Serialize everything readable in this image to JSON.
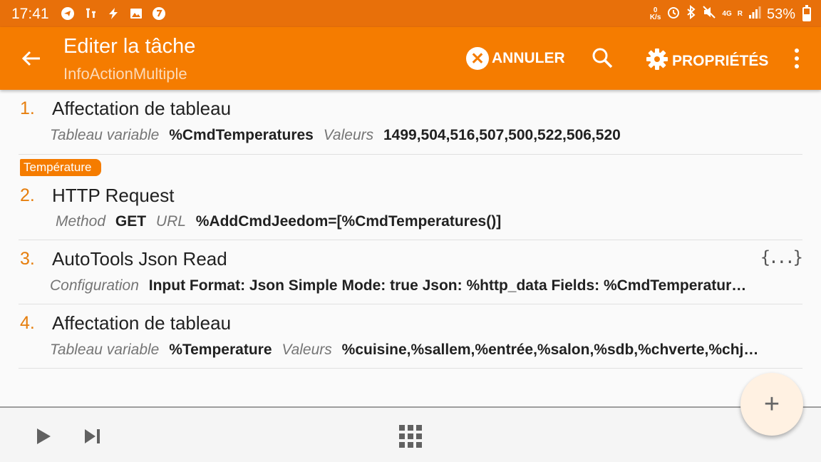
{
  "status_bar": {
    "time": "17:41",
    "left_icons": [
      "telegram-icon",
      "tasker-icon",
      "flash-icon",
      "image-icon",
      "viber-icon"
    ],
    "speed_value": "0",
    "speed_unit": "K/s",
    "net_4g": "4G",
    "net_r": "R",
    "battery": "53%"
  },
  "toolbar": {
    "title": "Editer la tâche",
    "subtitle": "InfoActionMultiple",
    "cancel_label": "ANNULER",
    "properties_label": "PROPRIÉTÉS"
  },
  "actions": [
    {
      "number": "1.",
      "name": "Affectation de tableau",
      "params": [
        {
          "label": "Tableau variable",
          "value": "%CmdTemperatures"
        },
        {
          "label": "Valeurs",
          "value": "1499,504,516,507,500,522,506,520"
        }
      ]
    },
    {
      "number": "2.",
      "tag": "Température",
      "name": "HTTP Request",
      "params": [
        {
          "label": "Method",
          "value": "GET"
        },
        {
          "label": "URL",
          "value": "%AddCmdJeedom=[%CmdTemperatures()]"
        }
      ]
    },
    {
      "number": "3.",
      "name": "AutoTools Json Read",
      "icon": "{...}",
      "params": [
        {
          "label": "Configuration",
          "value": "Input Format: Json Simple Mode: true Json: %http_data Fields: %CmdTemperatur…"
        }
      ]
    },
    {
      "number": "4.",
      "name": "Affectation de tableau",
      "params": [
        {
          "label": "Tableau variable",
          "value": "%Temperature"
        },
        {
          "label": "Valeurs",
          "value": "%cuisine,%sallem,%entrée,%salon,%sdb,%chverte,%chj…"
        }
      ]
    }
  ],
  "fab": "+",
  "colors": {
    "status_bar": "#e8700a",
    "toolbar": "#f57c00",
    "accent_number": "#e67e0d",
    "fab_bg": "#fff1e2"
  }
}
